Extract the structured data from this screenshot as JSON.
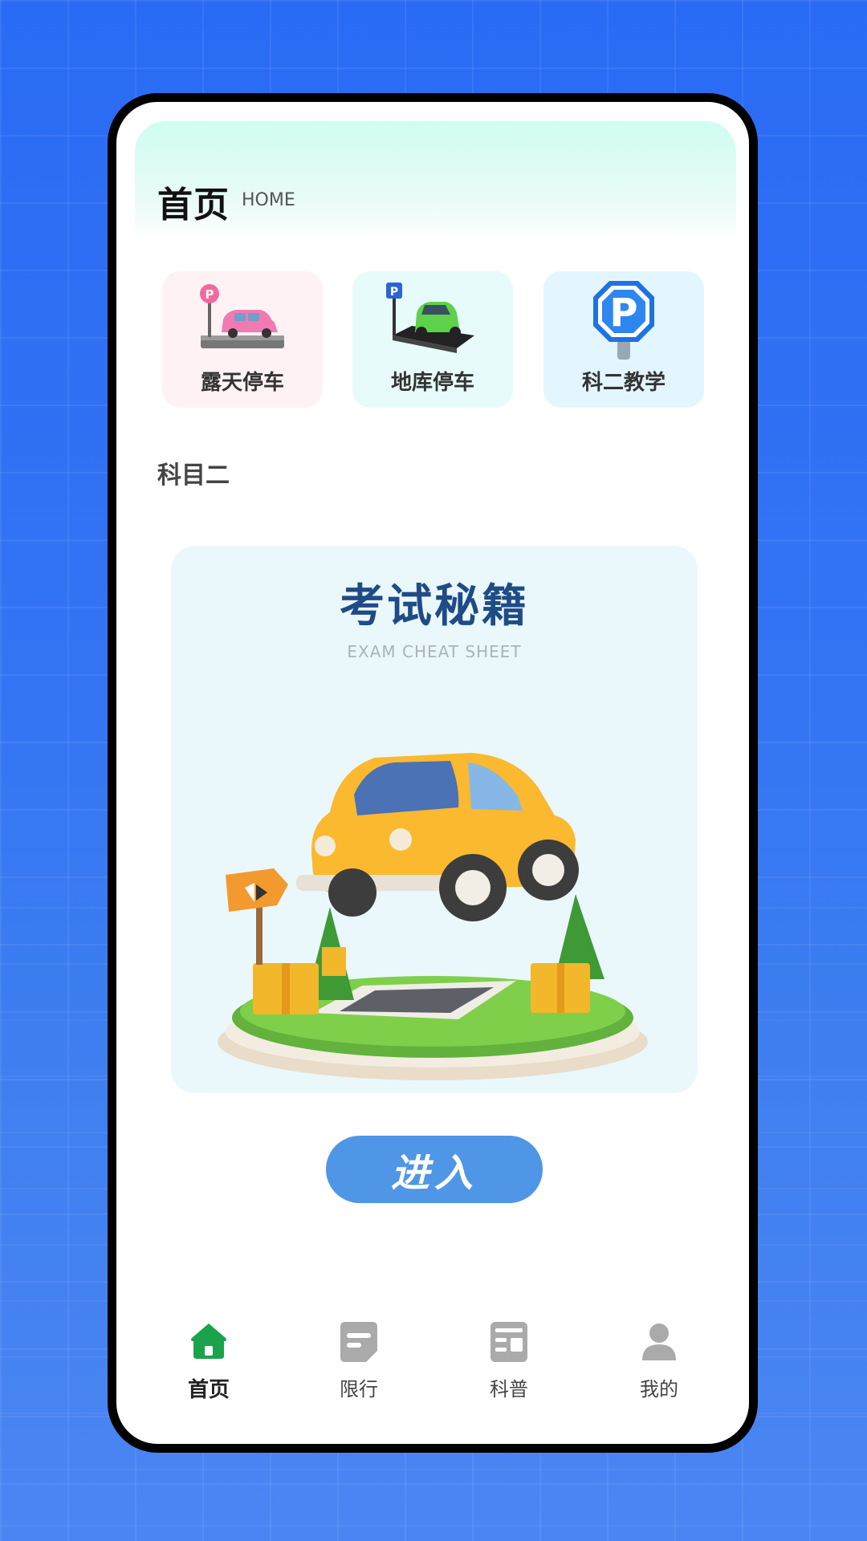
{
  "header": {
    "title": "首页",
    "subtitle": "HOME"
  },
  "tiles": [
    {
      "label": "露天停车",
      "icon": "pink-car-parking-icon"
    },
    {
      "label": "地库停车",
      "icon": "green-car-parking-icon"
    },
    {
      "label": "科二教学",
      "icon": "parking-sign-icon"
    }
  ],
  "section": {
    "label": "科目二"
  },
  "card": {
    "title": "考试秘籍",
    "subtitle": "EXAM CHEAT SHEET"
  },
  "enter_button": {
    "label": "进入"
  },
  "tabbar": {
    "items": [
      {
        "label": "首页",
        "icon": "home-icon",
        "active": true
      },
      {
        "label": "限行",
        "icon": "restriction-icon",
        "active": false
      },
      {
        "label": "科普",
        "icon": "news-icon",
        "active": false
      },
      {
        "label": "我的",
        "icon": "user-icon",
        "active": false
      }
    ]
  },
  "colors": {
    "accent": "#4f96e6",
    "active_tab": "#1aa34a",
    "inactive_tab": "#a9a9a9",
    "card_title": "#1f4b86"
  }
}
